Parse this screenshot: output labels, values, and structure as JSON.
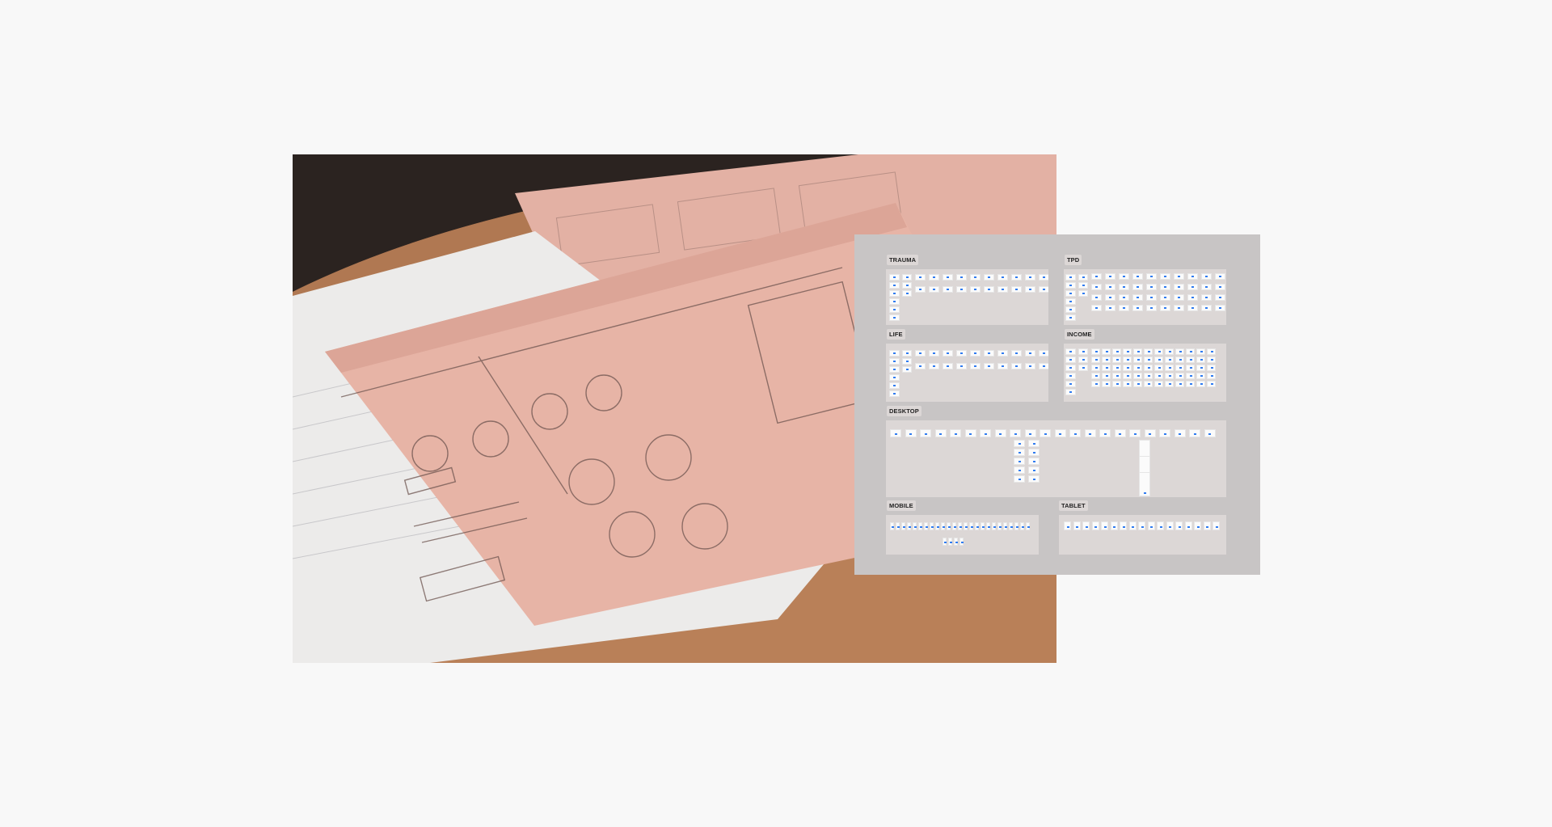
{
  "photo": {
    "subject": "paper-wireframe-sketches",
    "colors": {
      "sheet": "#e7b4a6",
      "notebook": "#ecebea",
      "table": "#b98058",
      "background": "#2b2320"
    }
  },
  "overview": {
    "background": "#c8c5c5",
    "section_background": "#dcd7d6",
    "accent": "#2f7bf0",
    "sections": [
      {
        "id": "trauma",
        "label": "TRAUMA"
      },
      {
        "id": "tpd",
        "label": "TPD"
      },
      {
        "id": "life",
        "label": "LIFE"
      },
      {
        "id": "income",
        "label": "INCOME"
      },
      {
        "id": "desktop",
        "label": "DESKTOP"
      },
      {
        "id": "mobile",
        "label": "MOBILE"
      },
      {
        "id": "tablet",
        "label": "TABLET"
      }
    ]
  }
}
